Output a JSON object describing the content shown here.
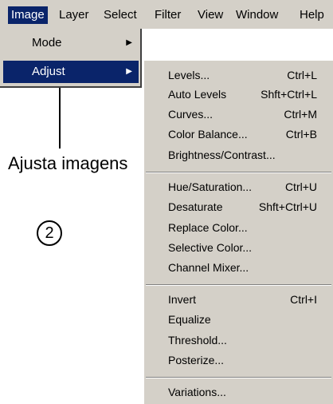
{
  "menubar": {
    "items": [
      "Image",
      "Layer",
      "Select",
      "Filter",
      "View",
      "Window",
      "Help"
    ]
  },
  "image_menu": {
    "items": [
      {
        "label": "Mode"
      },
      {
        "label": "Adjust"
      }
    ]
  },
  "adjust_menu": {
    "items": [
      {
        "label": "Levels...",
        "shortcut": "Ctrl+L"
      },
      {
        "label": "Auto Levels",
        "shortcut": "Shft+Ctrl+L"
      },
      {
        "label": "Curves...",
        "shortcut": "Ctrl+M"
      },
      {
        "label": "Color Balance...",
        "shortcut": "Ctrl+B"
      },
      {
        "label": "Brightness/Contrast...",
        "shortcut": ""
      },
      {
        "label": "Hue/Saturation...",
        "shortcut": "Ctrl+U"
      },
      {
        "label": "Desaturate",
        "shortcut": "Shft+Ctrl+U"
      },
      {
        "label": "Replace Color...",
        "shortcut": ""
      },
      {
        "label": "Selective Color...",
        "shortcut": ""
      },
      {
        "label": "Channel Mixer...",
        "shortcut": ""
      },
      {
        "label": "Invert",
        "shortcut": "Ctrl+I"
      },
      {
        "label": "Equalize",
        "shortcut": ""
      },
      {
        "label": "Threshold...",
        "shortcut": ""
      },
      {
        "label": "Posterize...",
        "shortcut": ""
      },
      {
        "label": "Variations...",
        "shortcut": ""
      }
    ]
  },
  "annotation": {
    "label": "Ajusta imagens",
    "step": "2"
  }
}
